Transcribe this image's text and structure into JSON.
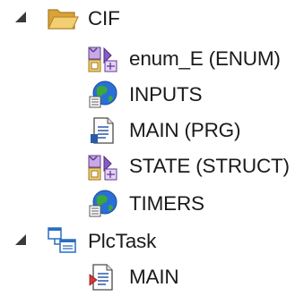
{
  "tree": {
    "nodes": [
      {
        "label": "CIF",
        "icon": "folder-open-icon",
        "expanded": true,
        "children": [
          {
            "label": "enum_E (ENUM)",
            "icon": "dut-icon"
          },
          {
            "label": "INPUTS",
            "icon": "gvl-globe-icon"
          },
          {
            "label": "MAIN (PRG)",
            "icon": "pou-program-icon"
          },
          {
            "label": "STATE (STRUCT)",
            "icon": "dut-icon"
          },
          {
            "label": "TIMERS",
            "icon": "gvl-globe-icon"
          }
        ]
      },
      {
        "label": "PlcTask",
        "icon": "task-icon",
        "expanded": true,
        "children": [
          {
            "label": "MAIN",
            "icon": "program-call-icon"
          }
        ]
      }
    ]
  },
  "colors": {
    "expander": "#3a3a3a",
    "folder": "#e8b84a",
    "globe_blue": "#2a6fd6",
    "globe_green": "#3aa83a",
    "task_blue": "#2b6cc4"
  }
}
